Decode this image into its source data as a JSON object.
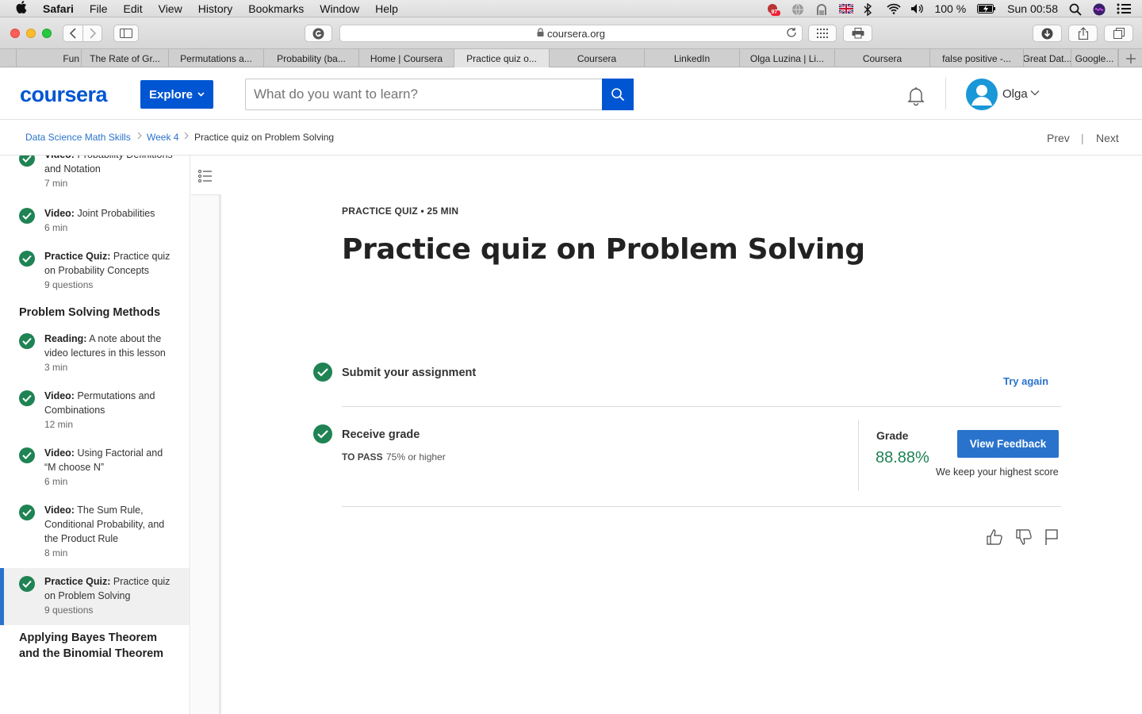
{
  "menubar": {
    "app": "Safari",
    "items": [
      "File",
      "Edit",
      "View",
      "History",
      "Bookmarks",
      "Window",
      "Help"
    ],
    "battery": "100 %",
    "clock": "Sun 00:58",
    "badge": "97"
  },
  "browser": {
    "url": "coursera.org",
    "tabs": [
      {
        "label": "Fun"
      },
      {
        "label": "The Rate of Gr..."
      },
      {
        "label": "Permutations a..."
      },
      {
        "label": "Probability (ba..."
      },
      {
        "label": "Home | Coursera"
      },
      {
        "label": "Practice quiz o...",
        "active": true
      },
      {
        "label": "Coursera"
      },
      {
        "label": "LinkedIn"
      },
      {
        "label": "Olga Luzina | Li..."
      },
      {
        "label": "Coursera"
      },
      {
        "label": "false positive -..."
      },
      {
        "label": "Great Dat..."
      },
      {
        "label": "Google..."
      }
    ]
  },
  "header": {
    "logo": "coursera",
    "explore": "Explore",
    "search_placeholder": "What do you want to learn?",
    "user": "Olga"
  },
  "breadcrumb": {
    "items": [
      "Data Science Math Skills",
      "Week 4"
    ],
    "current": "Practice quiz on Problem Solving",
    "prev": "Prev",
    "sep": "|",
    "next": "Next"
  },
  "sidebar": {
    "items_top": [
      {
        "kind": "Video:",
        "title": "Probability Definitions and Notation",
        "meta": "7 min"
      },
      {
        "kind": "Video:",
        "title": "Joint Probabilities",
        "meta": "6 min"
      },
      {
        "kind": "Practice Quiz:",
        "title": "Practice quiz on Probability Concepts",
        "meta": "9 questions"
      }
    ],
    "section_1": "Problem Solving Methods",
    "items_section": [
      {
        "kind": "Reading:",
        "title": "A note about the video lectures in this lesson",
        "meta": "3 min"
      },
      {
        "kind": "Video:",
        "title": "Permutations and Combinations",
        "meta": "12 min"
      },
      {
        "kind": "Video:",
        "title": "Using Factorial and “M choose N”",
        "meta": "6 min"
      },
      {
        "kind": "Video:",
        "title": "The Sum Rule, Conditional Probability, and the Product Rule",
        "meta": "8 min"
      },
      {
        "kind": "Practice Quiz:",
        "title": "Practice quiz on Problem Solving",
        "meta": "9 questions",
        "active": true
      }
    ],
    "section_2": "Applying Bayes Theorem and the Binomial Theorem"
  },
  "main": {
    "eyebrow": "PRACTICE QUIZ • 25 MIN",
    "title": "Practice quiz on Problem Solving",
    "submit_label": "Submit your assignment",
    "try_again": "Try again",
    "receive_label": "Receive grade",
    "to_pass_label": "TO PASS",
    "to_pass_value": "75% or higher",
    "grade_label": "Grade",
    "grade_value": "88.88%",
    "view_feedback": "View Feedback",
    "highest_note": "We keep your highest score"
  },
  "colors": {
    "brand": "#0056d2",
    "link": "#2a73cc",
    "success": "#1f8354"
  }
}
